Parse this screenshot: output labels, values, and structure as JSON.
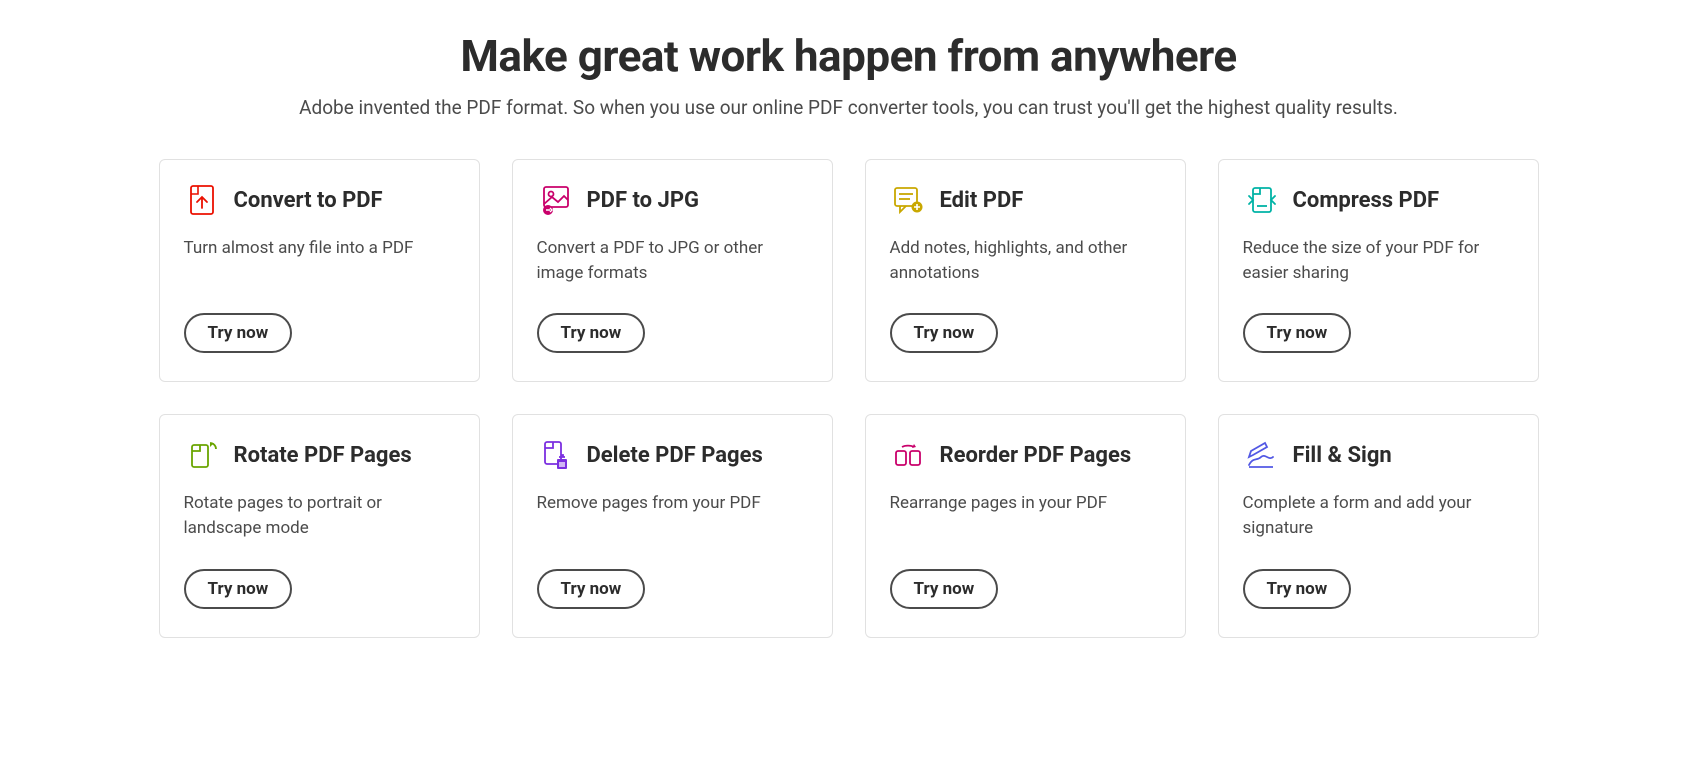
{
  "hero": {
    "title": "Make great work happen from anywhere",
    "subtitle": "Adobe invented the PDF format. So when you use our online PDF converter tools, you can trust you'll get the highest quality results."
  },
  "button_label": "Try now",
  "cards": [
    {
      "title": "Convert to PDF",
      "desc": "Turn almost any file into a PDF"
    },
    {
      "title": "PDF to JPG",
      "desc": "Convert a PDF to JPG or other image formats"
    },
    {
      "title": "Edit PDF",
      "desc": "Add notes, highlights, and other annotations"
    },
    {
      "title": "Compress PDF",
      "desc": "Reduce the size of your PDF for easier sharing"
    },
    {
      "title": "Rotate PDF Pages",
      "desc": "Rotate pages to portrait or landscape mode"
    },
    {
      "title": "Delete PDF Pages",
      "desc": "Remove pages from your PDF"
    },
    {
      "title": "Reorder PDF Pages",
      "desc": "Rearrange pages in your PDF"
    },
    {
      "title": "Fill & Sign",
      "desc": "Complete a form and add your signature"
    }
  ]
}
